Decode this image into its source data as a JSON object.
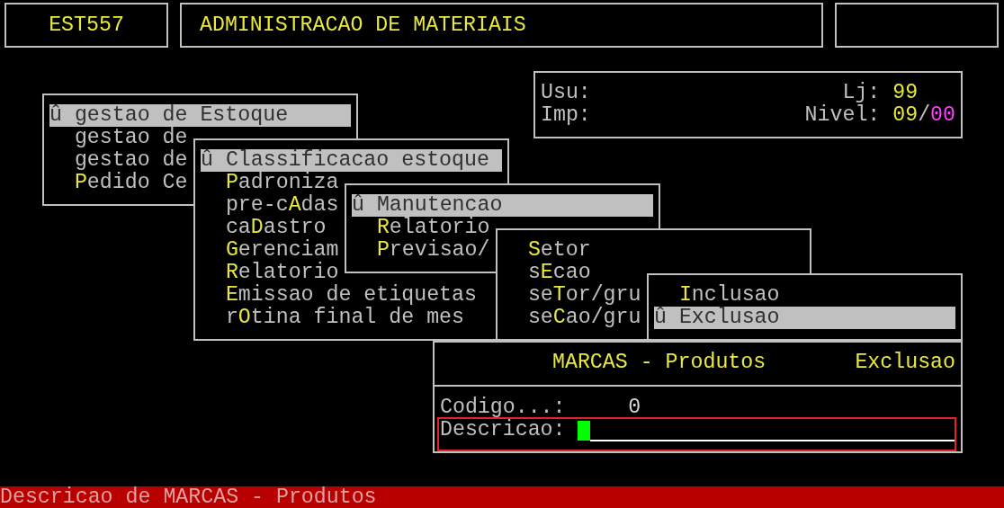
{
  "header": {
    "program_code": "EST557",
    "title": "ADMINISTRACAO DE MATERIAIS"
  },
  "info_panel": {
    "user_label": "Usu:",
    "printer_label": "Imp:",
    "store_label": "Lj:",
    "store_value": "99",
    "level_label": "Nivel:",
    "level_value": "09",
    "level_separator": "/",
    "level_sub_value": "00"
  },
  "menus": [
    {
      "items": [
        {
          "marker": "û",
          "text": "gestao de Estoque",
          "selected": true
        },
        {
          "text": "gestao de",
          "selected": false
        },
        {
          "text": "gestao de",
          "selected": false
        },
        {
          "hotkey": "P",
          "text_after": "edido Ce",
          "selected": false
        }
      ]
    },
    {
      "items": [
        {
          "marker": "û",
          "text": "Classificacao estoque",
          "selected": true
        },
        {
          "hotkey": "P",
          "text_after": "adroniza",
          "selected": false
        },
        {
          "text": "pre-c",
          "hotkey": "A",
          "text_after": "das",
          "selected": false
        },
        {
          "text": "ca",
          "hotkey": "D",
          "text_after": "astro",
          "selected": false
        },
        {
          "hotkey": "G",
          "text_after": "erenciam",
          "selected": false
        },
        {
          "hotkey": "R",
          "text_after": "elatorio",
          "selected": false
        },
        {
          "hotkey": "E",
          "text_after": "missao de etiquetas",
          "selected": false
        },
        {
          "text": "r",
          "hotkey": "O",
          "text_after": "tina final de mes",
          "selected": false
        }
      ]
    },
    {
      "items": [
        {
          "marker": "û",
          "text": "Manutencao",
          "selected": true
        },
        {
          "hotkey": "R",
          "text_after": "elatorio",
          "selected": false
        },
        {
          "hotkey": "P",
          "text_after": "revisao/",
          "selected": false
        }
      ]
    },
    {
      "items": [
        {
          "hotkey": "S",
          "text_after": "etor",
          "selected": false
        },
        {
          "text": "s",
          "hotkey": "E",
          "text_after": "cao",
          "selected": false
        },
        {
          "text": "se",
          "hotkey": "T",
          "text_after": "or/gru",
          "selected": false
        },
        {
          "text": "se",
          "hotkey": "C",
          "text_after": "ao/gru",
          "selected": false
        }
      ]
    },
    {
      "items": [
        {
          "hotkey": "I",
          "text_after": "nclusao",
          "selected": false
        },
        {
          "marker": "û",
          "text": "Exclusao",
          "selected": true
        }
      ]
    }
  ],
  "form": {
    "title": "MARCAS - Produtos",
    "mode": "Exclusao",
    "fields": [
      {
        "label": "Codigo...:",
        "value": "0",
        "focused": false
      },
      {
        "label": "Descricao:",
        "focused": true
      }
    ]
  },
  "status_bar": "Descricao de MARCAS - Produtos"
}
